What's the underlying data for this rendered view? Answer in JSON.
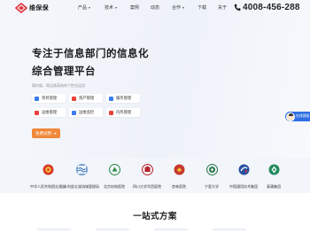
{
  "brand": {
    "name": "维保保",
    "accent": "#e3343a"
  },
  "nav": [
    {
      "label": "产品",
      "dropdown": true
    },
    {
      "label": "技术",
      "dropdown": true
    },
    {
      "label": "案例",
      "dropdown": false
    },
    {
      "label": "动态",
      "dropdown": false
    },
    {
      "label": "合作",
      "dropdown": true
    },
    {
      "label": "下载",
      "dropdown": false
    },
    {
      "label": "关于",
      "dropdown": false
    }
  ],
  "phone": "4008-456-288",
  "hero": {
    "title_line1": "专注于信息部门的信息化",
    "title_line2": "综合管理平台",
    "subtitle": "简约版，简洁版高效的个性化运用",
    "features": [
      {
        "label": "项目管理",
        "icon": "project-icon",
        "color": "#3a7df0"
      },
      {
        "label": "资产管理",
        "icon": "asset-icon",
        "color": "#e8413b"
      },
      {
        "label": "服务管理",
        "icon": "service-icon",
        "color": "#3a7df0"
      },
      {
        "label": "运维管理",
        "icon": "ops-icon",
        "color": "#e8413b"
      },
      {
        "label": "运维监控",
        "icon": "monitor-icon",
        "color": "#3a7df0"
      },
      {
        "label": "内务管理",
        "icon": "internal-icon",
        "color": "#e8413b"
      }
    ],
    "cta": "免费试用",
    "cta_color": "#f0883a"
  },
  "support": {
    "label": "在线客服"
  },
  "partners": [
    {
      "name": "中华人民共和国交通部",
      "color": "#d8392b"
    },
    {
      "name": "水利部太湖流域管理局",
      "color": "#2f6fb8"
    },
    {
      "name": "北京协和医院",
      "color": "#2c8c4a"
    },
    {
      "name": "四川大学华西医院",
      "color": "#b9242c"
    },
    {
      "name": "杏林医院",
      "color": "#c73a2e"
    },
    {
      "name": "宁夏大学",
      "color": "#2a7a4a"
    },
    {
      "name": "中国通用技术集团",
      "color": "#2850a0"
    },
    {
      "name": "泰康集团",
      "color": "#1f8a5c"
    }
  ],
  "section": {
    "title": "一站式方案"
  }
}
